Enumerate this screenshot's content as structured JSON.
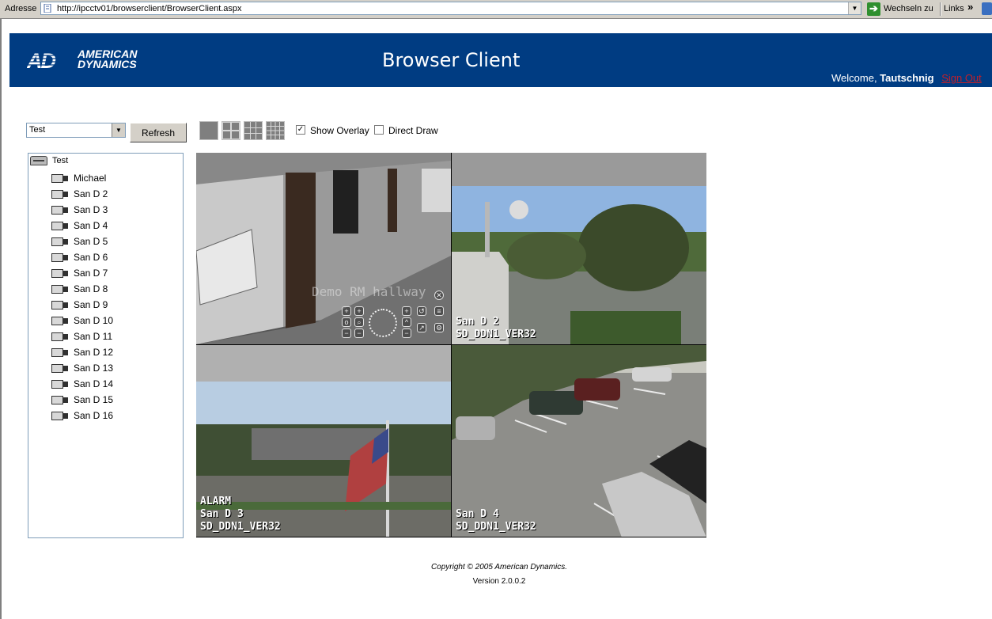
{
  "browser": {
    "address_label": "Adresse",
    "url": "http://ipcctv01/browserclient/BrowserClient.aspx",
    "go_label": "Wechseln zu",
    "links_label": "Links",
    "links_chevron": "»"
  },
  "header": {
    "logo_line1": "AMERICAN",
    "logo_line2": "DYNAMICS",
    "logo_mark": "AD",
    "title": "Browser Client",
    "welcome_prefix": "Welcome,",
    "username": "Tautschnig",
    "sign_out": "Sign Out",
    "background_color": "#003c82"
  },
  "controls": {
    "site_select_value": "Test",
    "refresh_label": "Refresh",
    "show_overlay_label": "Show Overlay",
    "show_overlay_checked": true,
    "direct_draw_label": "Direct Draw",
    "direct_draw_checked": false
  },
  "tree": {
    "root_label": "Test",
    "cameras": [
      "Michael",
      "San D 2",
      "San D 3",
      "San D 4",
      "San D 5",
      "San D 6",
      "San D 7",
      "San D 8",
      "San D 9",
      "San D 10",
      "San D 11",
      "San D 12",
      "San D 13",
      "San D 14",
      "San D 15",
      "San D 16"
    ]
  },
  "video": {
    "cell1_watermark": "Demo RM hallway",
    "cell2_overlay": [
      "San D 2",
      "SD_DDN1_VER32"
    ],
    "cell3_overlay": [
      "ALARM",
      "San D 3",
      "SD_DDN1_VER32"
    ],
    "cell4_overlay": [
      "San D 4",
      "SD_DDN1_VER32"
    ]
  },
  "footer": {
    "copyright": "Copyright © 2005 American Dynamics.",
    "version": "Version 2.0.0.2"
  }
}
